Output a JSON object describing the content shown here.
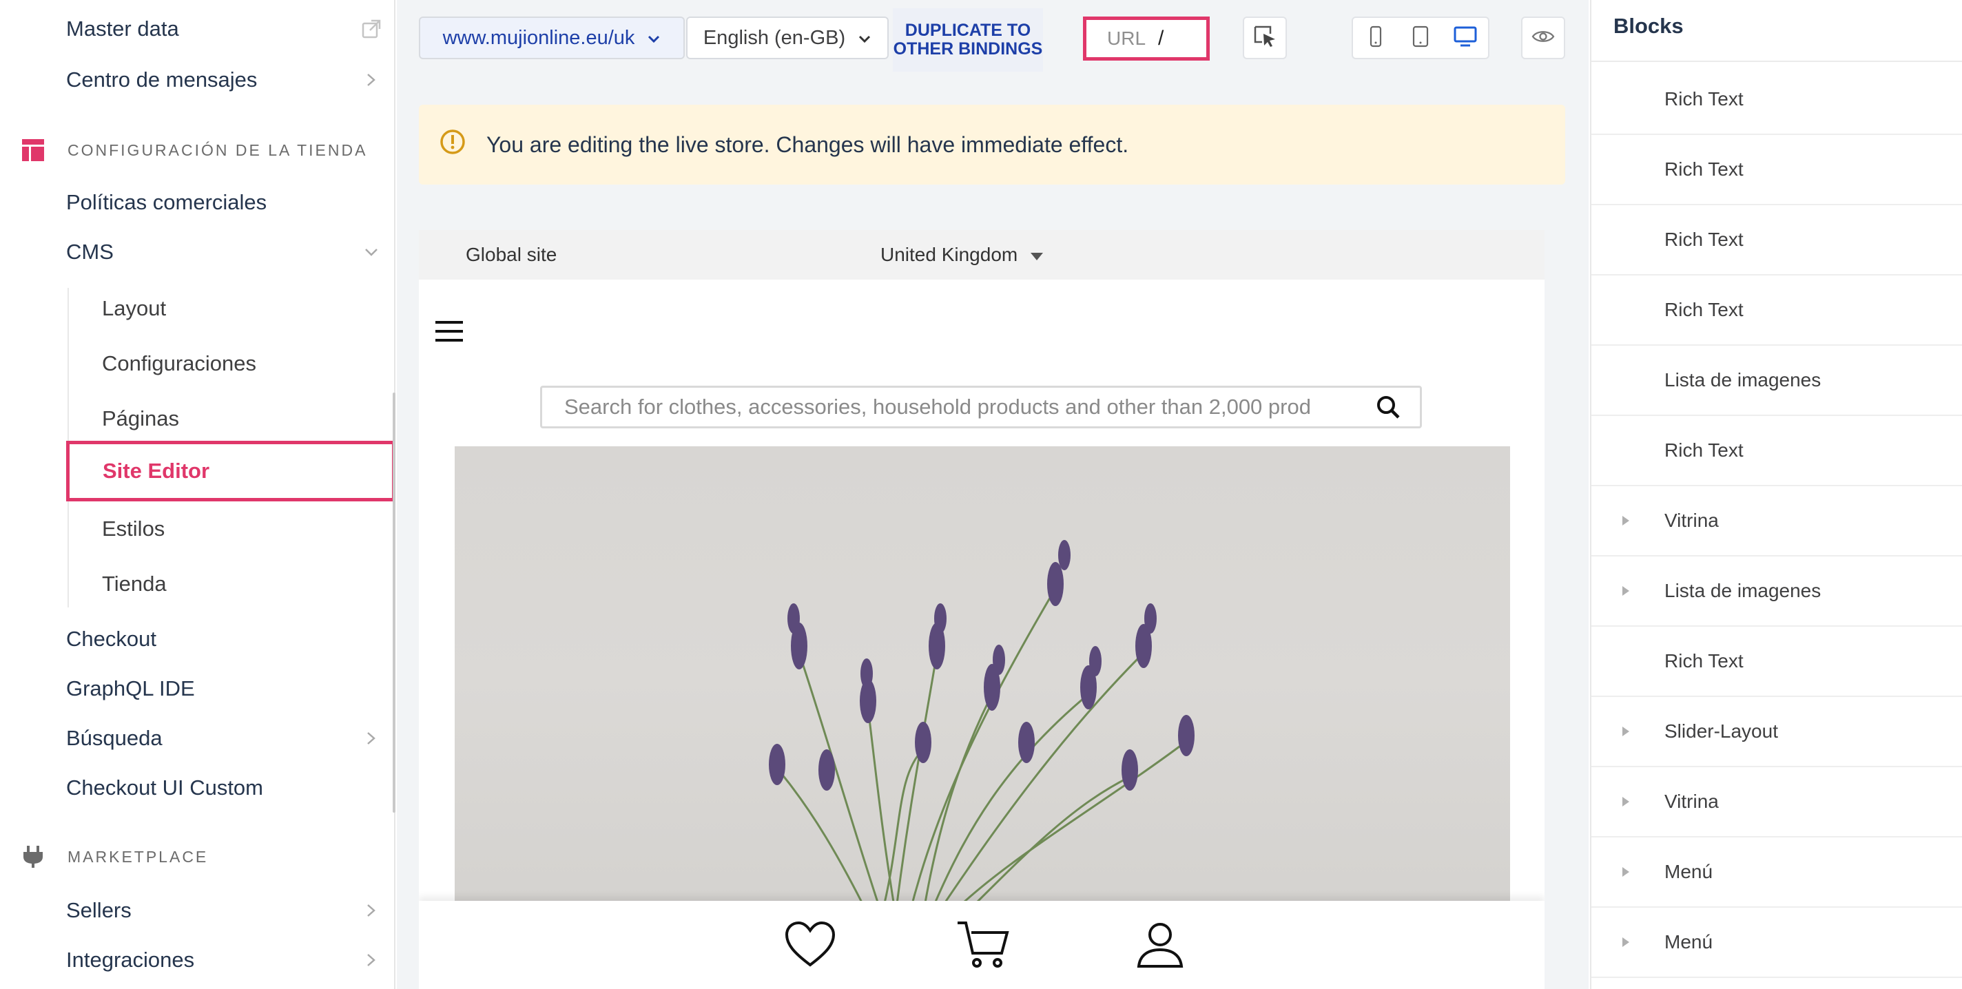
{
  "sidebar": {
    "master_data": "Master data",
    "message_center": "Centro de mensajes",
    "store_config_heading": "CONFIGURACIÓN DE LA TIENDA",
    "commercial_policies": "Políticas comerciales",
    "cms": "CMS",
    "cms_items": [
      "Layout",
      "Configuraciones",
      "Páginas",
      "Site Editor",
      "Estilos",
      "Tienda"
    ],
    "checkout": "Checkout",
    "graphql_ide": "GraphQL IDE",
    "search": "Búsqueda",
    "checkout_ui_custom": "Checkout UI Custom",
    "marketplace_heading": "MARKETPLACE",
    "sellers": "Sellers",
    "integrations": "Integraciones",
    "accent_color": "#e0376a"
  },
  "toolbar": {
    "binding": "www.mujionline.eu/uk",
    "language": "English (en-GB)",
    "duplicate_label": "DUPLICATE TO OTHER BINDINGS",
    "url_label": "URL",
    "url_value": "/"
  },
  "banner": {
    "message": "You are editing the live store. Changes will have immediate effect."
  },
  "preview": {
    "global_site": "Global site",
    "country": "United Kingdom",
    "search_placeholder": "Search for clothes, accessories, household products and other than 2,000 prod"
  },
  "blocks": {
    "title": "Blocks",
    "items": [
      {
        "label": "Rich Text",
        "expandable": false
      },
      {
        "label": "Rich Text",
        "expandable": false
      },
      {
        "label": "Rich Text",
        "expandable": false
      },
      {
        "label": "Rich Text",
        "expandable": false
      },
      {
        "label": "Lista de imagenes",
        "expandable": false
      },
      {
        "label": "Rich Text",
        "expandable": false
      },
      {
        "label": "Vitrina",
        "expandable": true
      },
      {
        "label": "Lista de imagenes",
        "expandable": true
      },
      {
        "label": "Rich Text",
        "expandable": false
      },
      {
        "label": "Slider-Layout",
        "expandable": true
      },
      {
        "label": "Vitrina",
        "expandable": true
      },
      {
        "label": "Menú",
        "expandable": true
      },
      {
        "label": "Menú",
        "expandable": true
      }
    ]
  }
}
